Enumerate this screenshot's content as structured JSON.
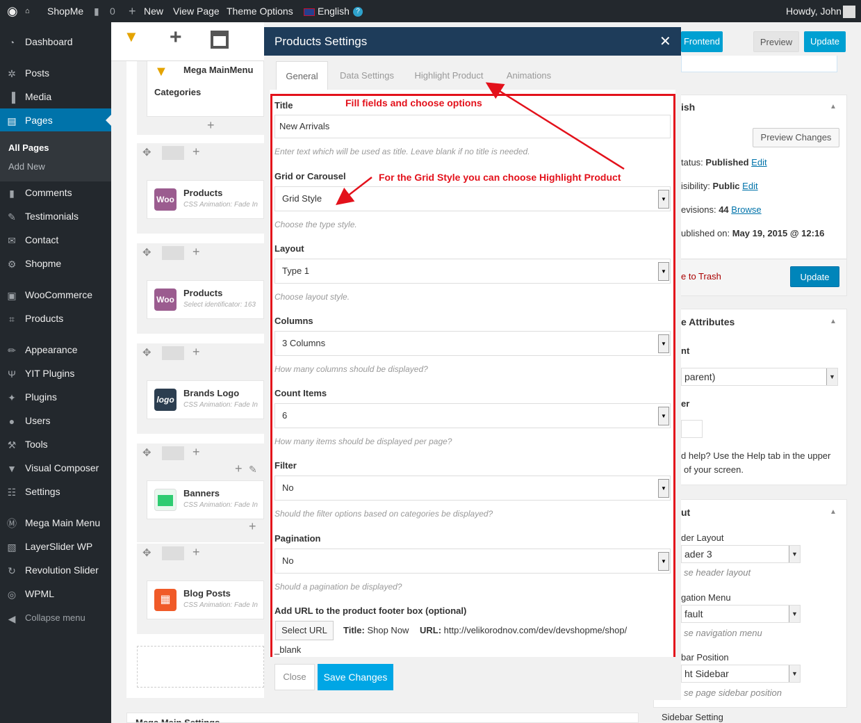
{
  "adminbar": {
    "site_name": "ShopMe",
    "comments_count": "0",
    "new_label": "New",
    "view_page": "View Page",
    "theme_options": "Theme Options",
    "language": "English",
    "howdy": "Howdy, John"
  },
  "menu": {
    "items": [
      {
        "label": "Dashboard",
        "icon": "dashboard-icon"
      },
      {
        "label": "Posts",
        "icon": "pin-icon"
      },
      {
        "label": "Media",
        "icon": "media-icon"
      },
      {
        "label": "Pages",
        "icon": "pages-icon"
      },
      {
        "label": "Comments",
        "icon": "comment-icon"
      },
      {
        "label": "Testimonials",
        "icon": "edit-icon"
      },
      {
        "label": "Contact",
        "icon": "mail-icon"
      },
      {
        "label": "Shopme",
        "icon": "gear-icon"
      },
      {
        "label": "WooCommerce",
        "icon": "woo-icon"
      },
      {
        "label": "Products",
        "icon": "cart-icon"
      },
      {
        "label": "Appearance",
        "icon": "brush-icon"
      },
      {
        "label": "YIT Plugins",
        "icon": "yit-icon"
      },
      {
        "label": "Plugins",
        "icon": "plugin-icon"
      },
      {
        "label": "Users",
        "icon": "user-icon"
      },
      {
        "label": "Tools",
        "icon": "wrench-icon"
      },
      {
        "label": "Visual Composer",
        "icon": "vc-icon"
      },
      {
        "label": "Settings",
        "icon": "settings-icon"
      },
      {
        "label": "Mega Main Menu",
        "icon": "mega-icon"
      },
      {
        "label": "LayerSlider WP",
        "icon": "layers-icon"
      },
      {
        "label": "Revolution Slider",
        "icon": "refresh-icon"
      },
      {
        "label": "WPML",
        "icon": "wpml-icon"
      }
    ],
    "collapse": "Collapse menu",
    "pages_sub": {
      "all": "All Pages",
      "add": "Add New"
    }
  },
  "builder": {
    "elements": [
      {
        "title": "Mega MainMenu",
        "title2": "Categories",
        "sub": ""
      },
      {
        "title": "Products",
        "sub": "CSS Animation: Fade In",
        "icon": "Woo"
      },
      {
        "title": "Products",
        "sub": "Select identificator: 163",
        "icon": "Woo"
      },
      {
        "title": "Brands Logo",
        "sub": "CSS Animation: Fade In",
        "icon": "logo"
      },
      {
        "title": "Banners",
        "sub": "CSS Animation: Fade In",
        "icon": ""
      },
      {
        "title": "Blog Posts",
        "sub": "CSS Animation: Fade In",
        "icon": ""
      }
    ],
    "bottom_label": "Mega Main Settings"
  },
  "right": {
    "frontend": "Frontend",
    "preview": "Preview",
    "update": "Update",
    "publish": {
      "title": "ish",
      "preview_changes": "Preview Changes",
      "status_label": "tatus:",
      "status_value": "Published",
      "edit": "Edit",
      "visibility_label": "isibility:",
      "visibility_value": "Public",
      "revisions_label": "evisions:",
      "revisions_value": "44",
      "browse": "Browse",
      "published_label": "ublished on:",
      "published_value": "May 19, 2015 @ 12:16",
      "trash": "e to Trash",
      "update": "Update"
    },
    "attributes": {
      "title": "e Attributes",
      "parent_label": "nt",
      "parent_value": "parent)",
      "order_label": "er",
      "help": "d help? Use the Help tab in the upper",
      "help2": "of your screen."
    },
    "layout": {
      "title": "ut",
      "header_label": "der Layout",
      "header_value": "ader 3",
      "header_desc": "se header layout",
      "nav_label": "gation Menu",
      "nav_value": "fault",
      "nav_desc": "se navigation menu",
      "sidebar_label": "bar Position",
      "sidebar_value": "ht Sidebar",
      "sidebar_desc": "se page sidebar position",
      "sidebar_setting": "Sidebar Setting"
    }
  },
  "modal": {
    "title": "Products Settings",
    "tabs": [
      "General",
      "Data Settings",
      "Highlight Product",
      "Animations"
    ],
    "fields": {
      "title_label": "Title",
      "title_value": "New Arrivals",
      "title_desc": "Enter text which will be used as title. Leave blank if no title is needed.",
      "grid_label": "Grid or Carousel",
      "grid_value": "Grid Style",
      "grid_desc": "Choose the type style.",
      "layout_label": "Layout",
      "layout_value": "Type 1",
      "layout_desc": "Choose layout style.",
      "columns_label": "Columns",
      "columns_value": "3 Columns",
      "columns_desc": "How many columns should be displayed?",
      "count_label": "Count Items",
      "count_value": "6",
      "count_desc": "How many items should be displayed per page?",
      "filter_label": "Filter",
      "filter_value": "No",
      "filter_desc": "Should the filter options based on categories be displayed?",
      "pagination_label": "Pagination",
      "pagination_value": "No",
      "pagination_desc": "Should a pagination be displayed?",
      "url_label": "Add URL to the product footer box (optional)",
      "select_url": "Select URL",
      "url_title_label": "Title:",
      "url_title_value": "Shop Now",
      "url_label2": "URL:",
      "url_value": "http://velikorodnov.com/dev/devshopme/shop/",
      "url_target": "_blank"
    },
    "close": "Close",
    "save": "Save Changes"
  },
  "annotations": {
    "note1": "Fill fields and choose options",
    "note2": "For the Grid Style you can choose Highlight Product",
    "color": "#e3111b"
  }
}
